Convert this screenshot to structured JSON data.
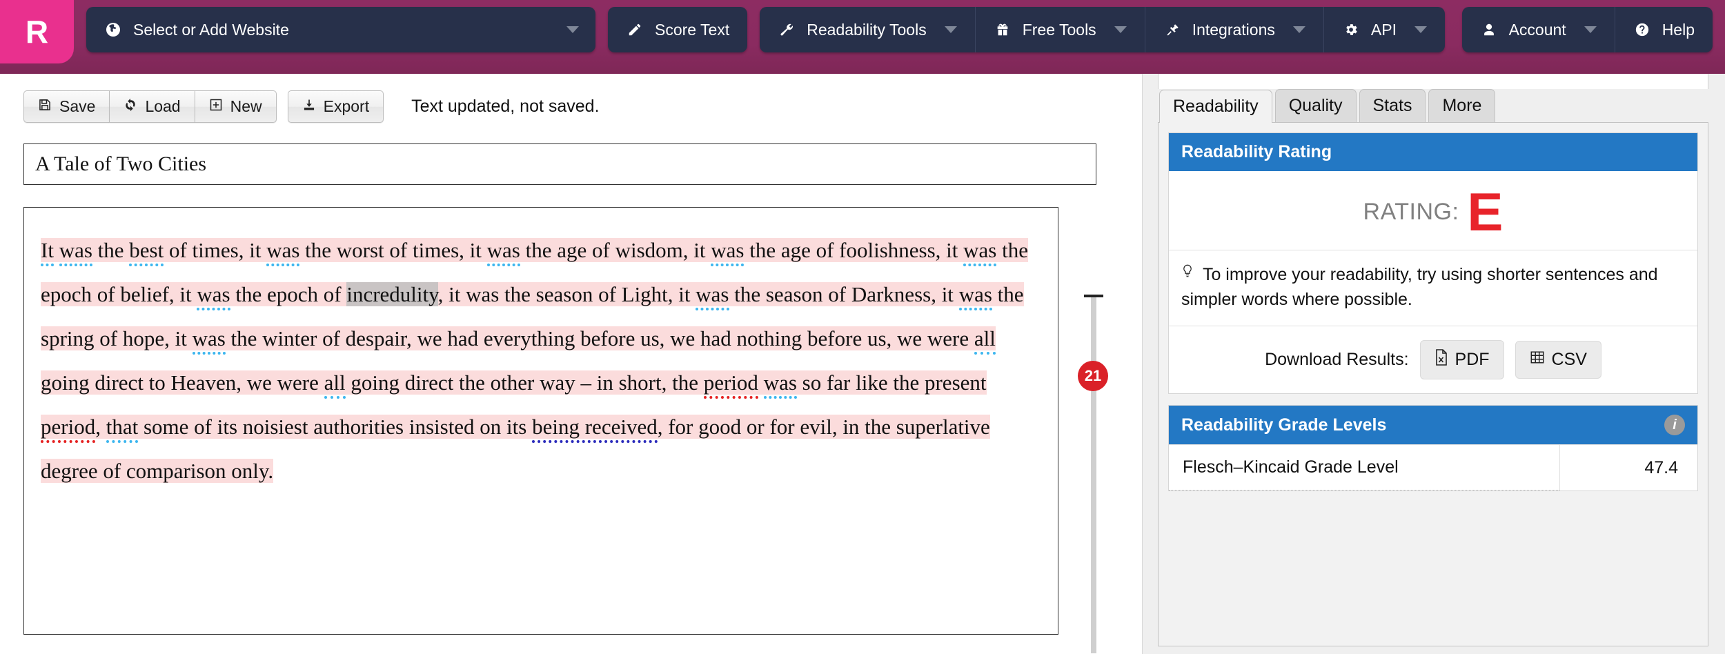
{
  "topnav": {
    "logo_letter": "R",
    "items": [
      {
        "label": "Select or Add Website",
        "icon": "globe-icon",
        "has_caret": true
      },
      {
        "label": "Score Text",
        "icon": "pencil-icon",
        "has_caret": false
      },
      {
        "label": "Readability Tools",
        "icon": "wrench-icon",
        "has_caret": true
      },
      {
        "label": "Free Tools",
        "icon": "gift-icon",
        "has_caret": true
      },
      {
        "label": "Integrations",
        "icon": "plug-icon",
        "has_caret": true
      },
      {
        "label": "API",
        "icon": "gear-icon",
        "has_caret": true
      },
      {
        "label": "Account",
        "icon": "user-icon",
        "has_caret": true
      },
      {
        "label": "Help",
        "icon": "question-circle-icon",
        "has_caret": false
      }
    ]
  },
  "toolbar": {
    "save_label": "Save",
    "load_label": "Load",
    "new_label": "New",
    "export_label": "Export",
    "status": "Text updated, not saved."
  },
  "editor": {
    "title_value": "A Tale of Two Cities",
    "body_plain": "It was the best of times, it was the worst of times, it was the age of wisdom, it was the age of foolishness, it was the epoch of belief, it was the epoch of incredulity, it was the season of Light, it was the season of Darkness, it was the spring of hope, it was the winter of despair, we had everything before us, we had nothing before us, we were all going direct to Heaven, we were all going direct the other way – in short, the period was so far like the present period, that some of its noisiest authorities insisted on its being received, for good or for evil, in the superlative degree of comparison only."
  },
  "marker_rail": {
    "badge_count": "21"
  },
  "sidebar": {
    "tabs": [
      {
        "label": "Readability",
        "active": true
      },
      {
        "label": "Quality",
        "active": false
      },
      {
        "label": "Stats",
        "active": false
      },
      {
        "label": "More",
        "active": false
      }
    ],
    "rating_card": {
      "header": "Readability Rating",
      "rating_label": "RATING:",
      "rating_value": "E",
      "rating_color": "#e8232a",
      "tip": "To improve your readability, try using shorter sentences and simpler words where possible.",
      "download_label": "Download Results:",
      "pdf_label": "PDF",
      "csv_label": "CSV"
    },
    "grades_card": {
      "header": "Readability Grade Levels",
      "rows": [
        {
          "name": "Flesch–Kincaid Grade Level",
          "value": "47.4"
        }
      ]
    }
  },
  "colors": {
    "brand_pink": "#e9308e",
    "brand_maroon": "#8d2c62",
    "nav_dark": "#27304a",
    "accent_blue": "#2378c4",
    "highlight_pink": "#fbdcdc",
    "badge_red": "#da2128"
  }
}
